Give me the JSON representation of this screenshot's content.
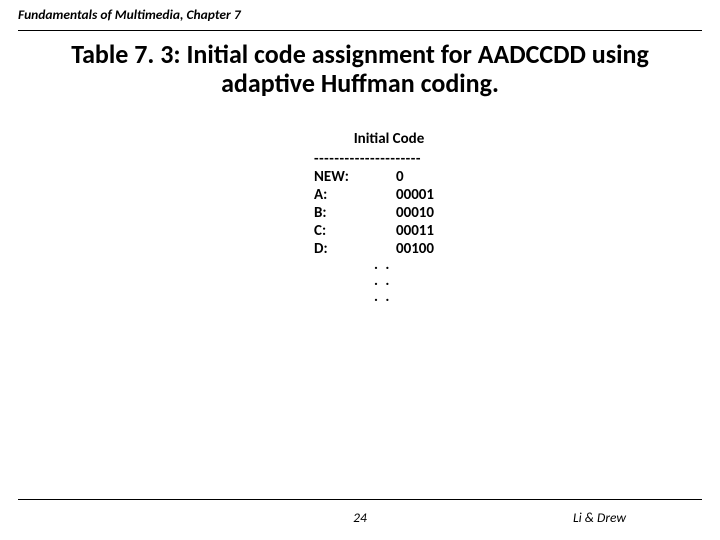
{
  "chapter": "Fundamentals of Multimedia, Chapter 7",
  "title_line1": "Table 7. 3: Initial code assignment for AADCCDD using",
  "title_line2": "adaptive Huffman coding.",
  "code": {
    "header": "Initial Code",
    "divider": "---------------------",
    "rows": [
      {
        "symbol": "NEW:",
        "value": "0"
      },
      {
        "symbol": "A:",
        "value": "00001"
      },
      {
        "symbol": "B:",
        "value": "00010"
      },
      {
        "symbol": "C:",
        "value": "00011"
      },
      {
        "symbol": "D:",
        "value": "00100"
      }
    ],
    "ellipsis": [
      ". .",
      ". .",
      ". ."
    ]
  },
  "page_number": "24",
  "authors": "Li & Drew"
}
